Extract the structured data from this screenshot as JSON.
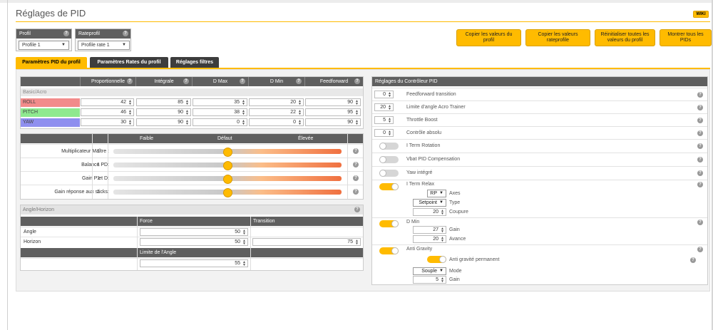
{
  "page": {
    "title": "Réglages de PID",
    "wiki": "WIKI"
  },
  "profile": {
    "label": "Profil",
    "value": "Profile 1"
  },
  "rateprofile": {
    "label": "Rateprofil",
    "value": "Profile rate 1"
  },
  "actions": {
    "copy_pid": "Copier les valeurs du profil",
    "copy_rates": "Copier les valeurs rateprofile",
    "reset": "Réinitialiser toutes les valeurs du profil",
    "show_all": "Montrer tous les PIDs"
  },
  "tabs": [
    "Paramètres PID du profil",
    "Paramètres Rates du profil",
    "Réglages filtres"
  ],
  "pid": {
    "columns": [
      "Proportionnelle",
      "Intégrale",
      "D Max",
      "D Min",
      "Feedforward"
    ],
    "group": "Basic/Acro",
    "rows": [
      {
        "axis": "ROLL",
        "color": "#f28b8b",
        "values": [
          "42",
          "85",
          "35",
          "20",
          "90"
        ]
      },
      {
        "axis": "PITCH",
        "color": "#8fe98f",
        "values": [
          "46",
          "90",
          "38",
          "22",
          "95"
        ]
      },
      {
        "axis": "YAW",
        "color": "#8f8fef",
        "values": [
          "30",
          "90",
          "0",
          "0",
          "90"
        ]
      }
    ]
  },
  "sliders": {
    "header": {
      "low": "Faible",
      "default": "Défaut",
      "high": "Élevée"
    },
    "rows": [
      {
        "label": "Multiplicateur Maître :",
        "value": "1",
        "position": 0.5
      },
      {
        "label": "Balance PD:",
        "value": "1",
        "position": 0.5
      },
      {
        "label": "Gain P et D:",
        "value": "1",
        "position": 0.5
      },
      {
        "label": "Gain réponse aux sticks:",
        "value": "1",
        "position": 0.5
      }
    ]
  },
  "angle": {
    "group": "Angle/Horizon",
    "force": "Force",
    "transition": "Transition",
    "angle_label": "Angle",
    "angle_force": "50",
    "horizon_label": "Horizon",
    "horizon_force": "50",
    "horizon_transition": "75",
    "limit_label": "Limite de l'Angle",
    "limit_value": "55"
  },
  "controller": {
    "title": "Réglages du Contrôleur PID",
    "ff_transition": {
      "value": "0",
      "label": "Feedforward transition"
    },
    "acro_trainer": {
      "value": "20",
      "label": "Limite d'angle Acro Trainer"
    },
    "throttle_boost": {
      "value": "5",
      "label": "Throttle Boost"
    },
    "absolute_control": {
      "value": "0",
      "label": "Contrôle absolu"
    },
    "iterm_rotation": {
      "label": "I Term Rotation",
      "on": false
    },
    "vbat_comp": {
      "label": "Vbat PID Compensation",
      "on": false
    },
    "integrated_yaw": {
      "label": "Yaw intégré",
      "on": false
    },
    "iterm_relax": {
      "label": "I Term Relax",
      "on": true,
      "axes_value": "RP",
      "axes_label": "Axes",
      "type_value": "Setpoint",
      "type_label": "Type",
      "cutoff_value": "20",
      "cutoff_label": "Coupure"
    },
    "dmin": {
      "label": "D Min",
      "on": true,
      "gain_value": "27",
      "gain_label": "Gain",
      "advance_value": "20",
      "advance_label": "Avance"
    },
    "anti_gravity": {
      "label": "Anti Gravity",
      "on": true,
      "permanent_label": "Anti gravité permanent",
      "permanent_on": true,
      "mode_value": "Souple",
      "mode_label": "Mode",
      "gain_value": "5",
      "gain_label": "Gain"
    }
  }
}
